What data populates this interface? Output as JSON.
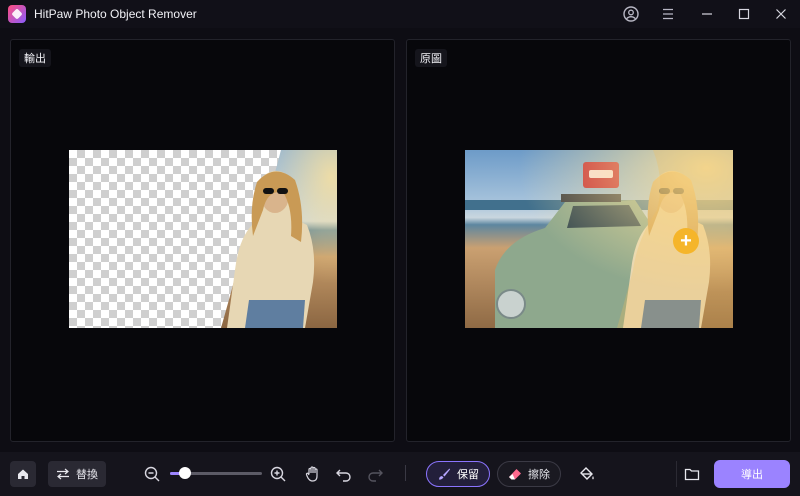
{
  "app": {
    "title": "HitPaw Photo Object Remover",
    "window_controls": [
      "user-icon",
      "menu-icon",
      "minimize-icon",
      "maximize-icon",
      "close-icon"
    ]
  },
  "panels": {
    "output_label": "輸出",
    "original_label": "原圖"
  },
  "toolbar": {
    "replace_label": "替換",
    "zoom_level": 0.16,
    "keep_label": "保留",
    "erase_label": "擦除",
    "export_label": "導出"
  },
  "colors": {
    "accent": "#9b83ff",
    "background": "#0e0d14",
    "marker": "#f5b52a"
  }
}
